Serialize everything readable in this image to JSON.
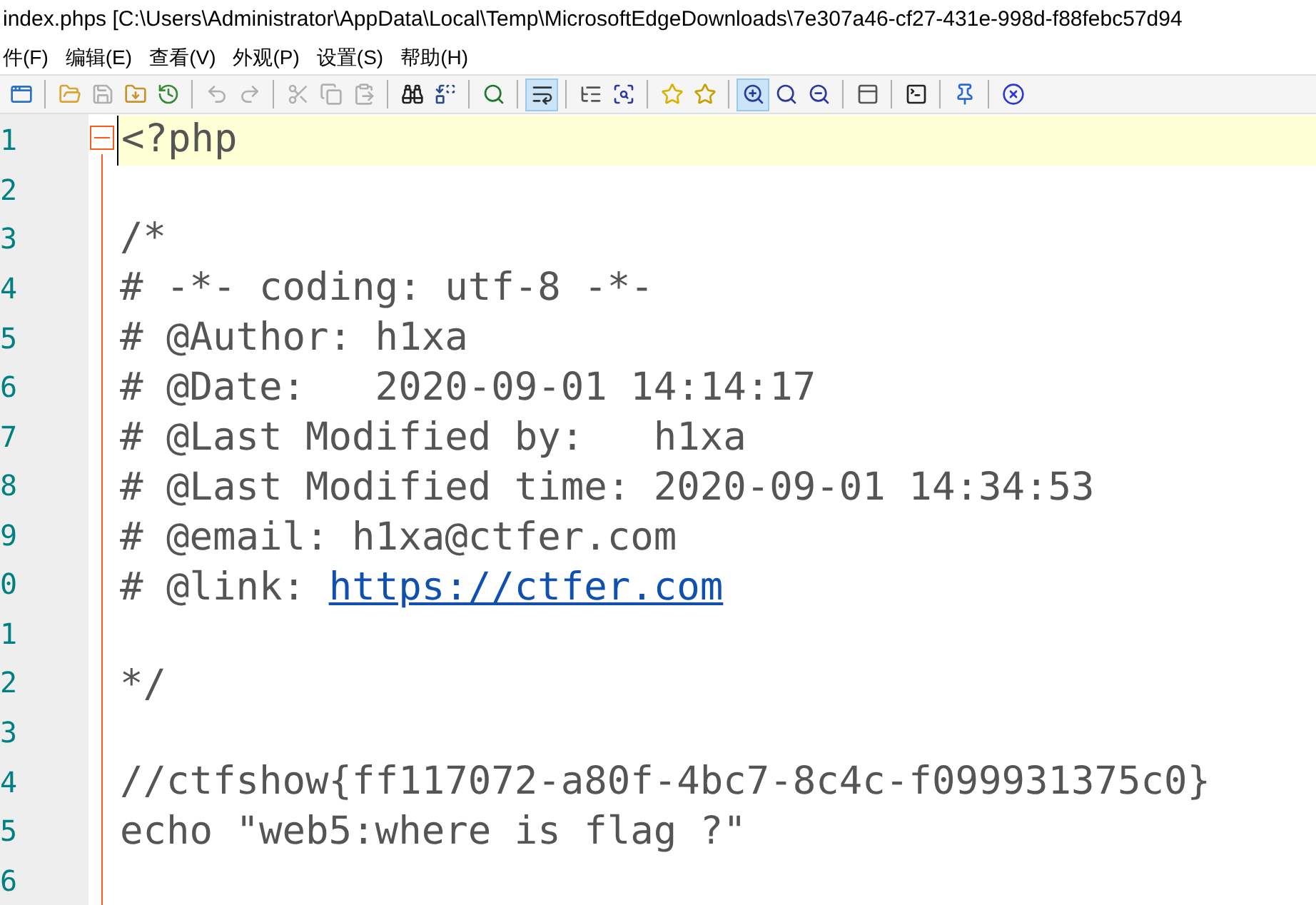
{
  "window": {
    "title": "index.phps [C:\\Users\\Administrator\\AppData\\Local\\Temp\\MicrosoftEdgeDownloads\\7e307a46-cf27-431e-998d-f88febc57d94"
  },
  "menu": [
    "件(F)",
    "编辑(E)",
    "查看(V)",
    "外观(P)",
    "设置(S)",
    "帮助(H)"
  ],
  "toolbar": [
    [
      {
        "kind": "windows",
        "pressed": false,
        "disabled": false
      }
    ],
    [
      {
        "kind": "open",
        "pressed": false,
        "disabled": false
      },
      {
        "kind": "save",
        "pressed": false,
        "disabled": true
      },
      {
        "kind": "save-as",
        "pressed": false,
        "disabled": false
      },
      {
        "kind": "reload",
        "pressed": false,
        "disabled": false
      }
    ],
    [
      {
        "kind": "undo",
        "pressed": false,
        "disabled": true
      },
      {
        "kind": "redo",
        "pressed": false,
        "disabled": true
      }
    ],
    [
      {
        "kind": "cut",
        "pressed": false,
        "disabled": true
      },
      {
        "kind": "copy",
        "pressed": false,
        "disabled": true
      },
      {
        "kind": "paste",
        "pressed": false,
        "disabled": true
      }
    ],
    [
      {
        "kind": "find",
        "pressed": false,
        "disabled": false
      },
      {
        "kind": "replace",
        "pressed": false,
        "disabled": false
      }
    ],
    [
      {
        "kind": "search",
        "pressed": false,
        "disabled": false
      }
    ],
    [
      {
        "kind": "wrap",
        "pressed": true,
        "disabled": false
      }
    ],
    [
      {
        "kind": "outline",
        "pressed": false,
        "disabled": false
      },
      {
        "kind": "zoom-fit",
        "pressed": false,
        "disabled": false
      }
    ],
    [
      {
        "kind": "favorite",
        "pressed": false,
        "disabled": false
      },
      {
        "kind": "add-favorite",
        "pressed": false,
        "disabled": false
      }
    ],
    [
      {
        "kind": "zoom-in",
        "pressed": true,
        "disabled": false
      },
      {
        "kind": "zoom-reset",
        "pressed": false,
        "disabled": false
      },
      {
        "kind": "zoom-out",
        "pressed": false,
        "disabled": false
      }
    ],
    [
      {
        "kind": "panel",
        "pressed": false,
        "disabled": false
      }
    ],
    [
      {
        "kind": "terminal",
        "pressed": false,
        "disabled": false
      }
    ],
    [
      {
        "kind": "pin",
        "pressed": false,
        "disabled": false
      }
    ],
    [
      {
        "kind": "close",
        "pressed": false,
        "disabled": false
      }
    ]
  ],
  "editor": {
    "fold_expanded": true,
    "lines": [
      {
        "number": "1",
        "text": "<?php",
        "current": true
      },
      {
        "number": "2",
        "current": false
      },
      {
        "number": "3",
        "text": "/*",
        "current": false
      },
      {
        "number": "4",
        "text": "# -*- coding: utf-8 -*-",
        "current": false
      },
      {
        "number": "5",
        "text": "# @Author: h1xa",
        "current": false
      },
      {
        "number": "6",
        "text": "# @Date:   2020-09-01 14:14:17",
        "current": false
      },
      {
        "number": "7",
        "text": "# @Last Modified by:   h1xa",
        "current": false
      },
      {
        "number": "8",
        "text": "# @Last Modified time: 2020-09-01 14:34:53",
        "current": false
      },
      {
        "number": "9",
        "text": "# @email: h1xa@ctfer.com",
        "current": false
      },
      {
        "number": "0",
        "text": "# @link: ",
        "link": "https://ctfer.com",
        "current": false
      },
      {
        "number": "1",
        "current": false
      },
      {
        "number": "2",
        "text": "*/",
        "current": false
      },
      {
        "number": "3",
        "current": false
      },
      {
        "number": "4",
        "text": "//ctfshow{ff117072-a80f-4bc7-8c4c-f099931375c0}",
        "current": false
      },
      {
        "number": "5",
        "text": "echo \"web5:where is flag ?\"",
        "current": false
      },
      {
        "number": "6",
        "current": false
      }
    ]
  }
}
